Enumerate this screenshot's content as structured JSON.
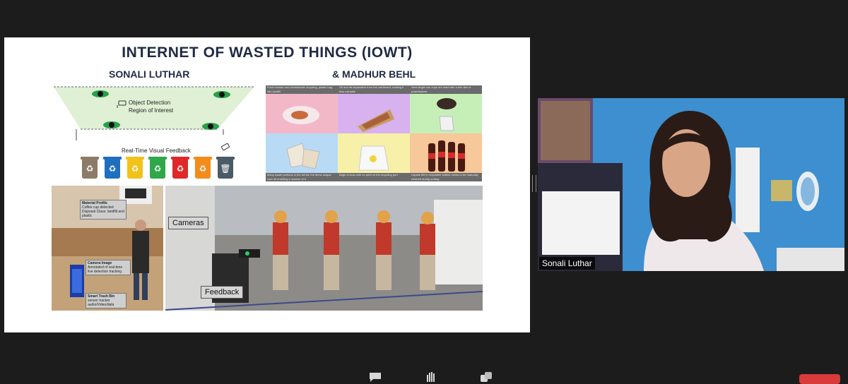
{
  "slide": {
    "title": "INTERNET OF WASTED THINGS (IOWT)",
    "author_left": "SONALI LUTHAR",
    "author_right": "& MADHUR BEHL",
    "diagram": {
      "roi_line1": "Object Detection",
      "roi_line2": "Region of Interest",
      "feedback_label": "Real-Time Visual Feedback",
      "bins": [
        {
          "color": "#8c7b66",
          "glyph": "♻"
        },
        {
          "color": "#1e6fc0",
          "glyph": "♻"
        },
        {
          "color": "#f2c21b",
          "glyph": "♻"
        },
        {
          "color": "#2ea84a",
          "glyph": "♻"
        },
        {
          "color": "#e02828",
          "glyph": "♻"
        },
        {
          "color": "#f28c1b",
          "glyph": "♻"
        },
        {
          "color": "#4a5a66",
          "glyph": "🗑"
        }
      ]
    },
    "grid": {
      "cells": [
        {
          "caption": "Food residue can contaminate recycling, plastic bag into landfill",
          "bg": "#f3b8c8",
          "pos": "top"
        },
        {
          "caption": "Oil and fat separation from the cardboard, making it less valuable",
          "bg": "#d7b2ef",
          "pos": "top"
        },
        {
          "caption": "Vent single-use cups are lined with a thin film of polyethylene",
          "bg": "#c6efb8",
          "pos": "top"
        },
        {
          "caption": "Many waste portions in the full bin the items unique over all enabling a number of it",
          "bg": "#b8daf5",
          "pos": "bottom"
        },
        {
          "caption": "Bags of toxic with no print on the recycling port",
          "bg": "#f7f0a8",
          "pos": "bottom"
        },
        {
          "caption": "Liquids left in recyclable bottles needs to be manually cleaned during sorting",
          "bg": "#f6c89a",
          "pos": "bottom"
        }
      ]
    },
    "left_photo": {
      "tag1_title": "Material Profile",
      "tag1_body": "Coffee cup detected Disposal Class: landfill and plastic",
      "tag2_title": "Camera Image",
      "tag2_body": "Annotated of real-time live detection tracking",
      "tag3_title": "Smart Trash Bin",
      "tag3_body": "sensor tracker audio/Video/data"
    },
    "right_photo": {
      "cameras_label": "Cameras",
      "feedback_label": "Feedback"
    }
  },
  "video": {
    "participant_name": "Sonali Luthar"
  },
  "colors": {
    "background": "#1c1c1c",
    "end_button": "#d93a3a"
  },
  "toolbar": {
    "icons": [
      "chat-icon",
      "raise-hand-icon",
      "reactions-icon"
    ]
  }
}
